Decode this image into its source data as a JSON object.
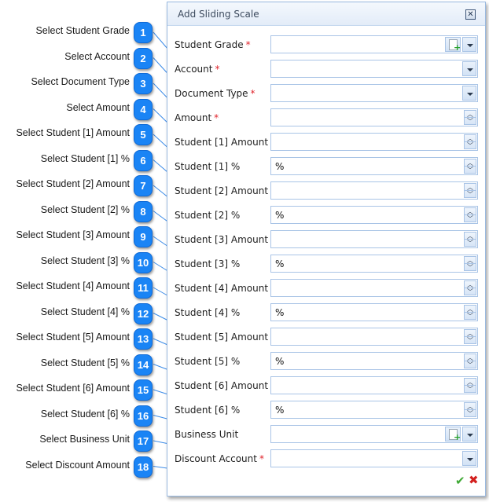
{
  "dialog": {
    "title": "Add Sliding Scale",
    "close_icon": "close-x-icon",
    "required_marker": "*",
    "fields": [
      {
        "label": "Student Grade",
        "required": true,
        "type": "combo-add",
        "value": ""
      },
      {
        "label": "Account",
        "required": true,
        "type": "combo",
        "value": ""
      },
      {
        "label": "Document Type",
        "required": true,
        "type": "combo",
        "value": ""
      },
      {
        "label": "Amount",
        "required": true,
        "type": "spin",
        "value": ""
      },
      {
        "label": "Student [1] Amount",
        "required": false,
        "type": "spin",
        "value": ""
      },
      {
        "label": "Student [1] %",
        "required": false,
        "type": "spin",
        "value": "%"
      },
      {
        "label": "Student [2] Amount",
        "required": false,
        "type": "spin",
        "value": ""
      },
      {
        "label": "Student [2] %",
        "required": false,
        "type": "spin",
        "value": "%"
      },
      {
        "label": "Student [3] Amount",
        "required": false,
        "type": "spin",
        "value": ""
      },
      {
        "label": "Student [3] %",
        "required": false,
        "type": "spin",
        "value": "%"
      },
      {
        "label": "Student [4] Amount",
        "required": false,
        "type": "spin",
        "value": ""
      },
      {
        "label": "Student [4] %",
        "required": false,
        "type": "spin",
        "value": "%"
      },
      {
        "label": "Student [5] Amount",
        "required": false,
        "type": "spin",
        "value": ""
      },
      {
        "label": "Student [5] %",
        "required": false,
        "type": "spin",
        "value": "%"
      },
      {
        "label": "Student [6] Amount",
        "required": false,
        "type": "spin",
        "value": ""
      },
      {
        "label": "Student [6] %",
        "required": false,
        "type": "spin",
        "value": "%"
      },
      {
        "label": "Business Unit",
        "required": false,
        "type": "combo-add",
        "value": ""
      },
      {
        "label": "Discount Account",
        "required": true,
        "type": "combo",
        "value": ""
      }
    ],
    "ok_icon": "check-icon",
    "cancel_icon": "cancel-x-icon"
  },
  "callouts": [
    {
      "number": "1",
      "text": "Select Student Grade"
    },
    {
      "number": "2",
      "text": "Select Account"
    },
    {
      "number": "3",
      "text": "Select Document Type"
    },
    {
      "number": "4",
      "text": "Select Amount"
    },
    {
      "number": "5",
      "text": "Select Student [1] Amount"
    },
    {
      "number": "6",
      "text": "Select Student [1] %"
    },
    {
      "number": "7",
      "text": "Select Student [2] Amount"
    },
    {
      "number": "8",
      "text": "Select Student [2] %"
    },
    {
      "number": "9",
      "text": "Select Student [3] Amount"
    },
    {
      "number": "10",
      "text": "Select Student [3] %"
    },
    {
      "number": "11",
      "text": "Select Student [4] Amount"
    },
    {
      "number": "12",
      "text": "Select Student [4] %"
    },
    {
      "number": "13",
      "text": "Select Student [5] Amount"
    },
    {
      "number": "14",
      "text": "Select Student [5] %"
    },
    {
      "number": "15",
      "text": "Select Student [6] Amount"
    },
    {
      "number": "16",
      "text": "Select Student [6] %"
    },
    {
      "number": "17",
      "text": "Select Business Unit"
    },
    {
      "number": "18",
      "text": "Select Discount Amount"
    }
  ],
  "colors": {
    "badge": "#1a84f5",
    "required": "#e0232b",
    "field_border": "#a9c4e6",
    "ok": "#3fa935",
    "cancel": "#d3201e"
  }
}
